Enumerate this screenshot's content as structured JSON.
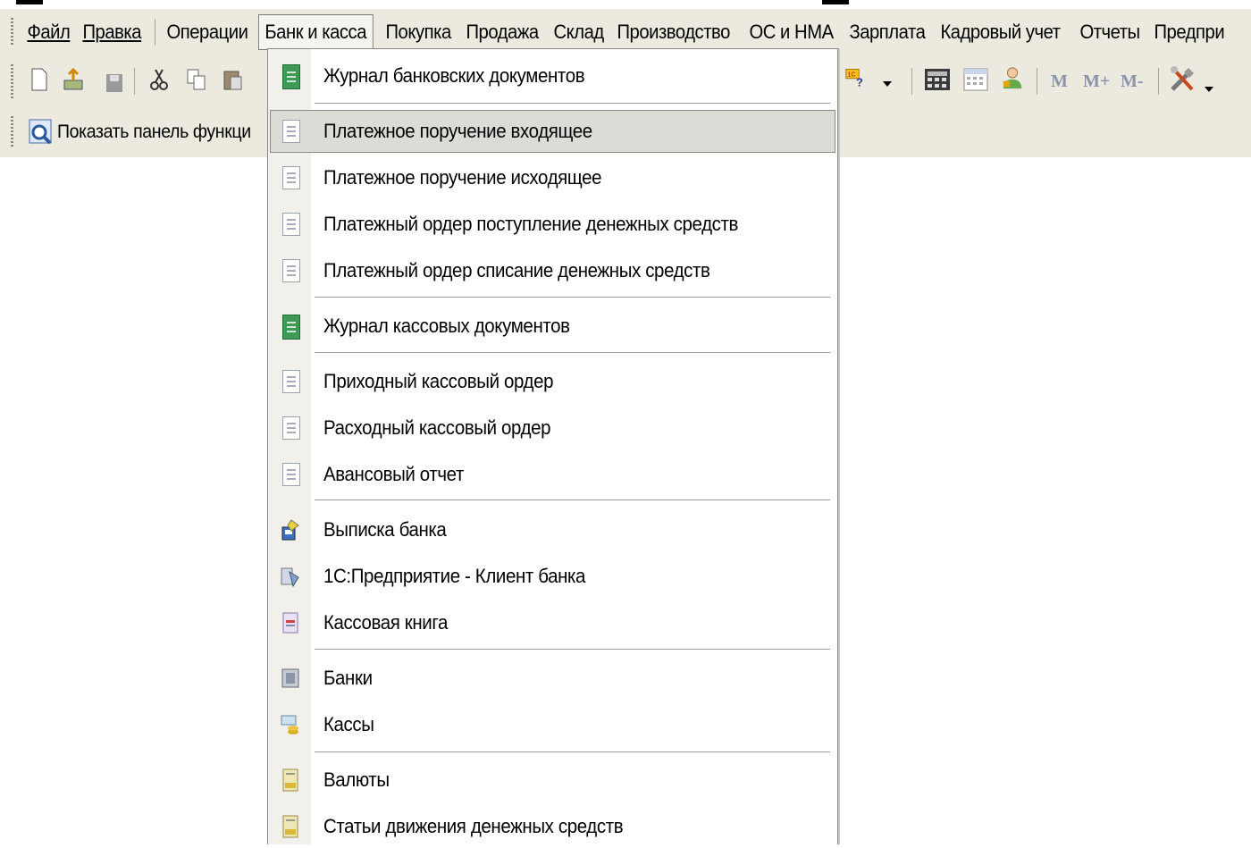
{
  "menubar": {
    "items": [
      {
        "label": "Файл",
        "underline_first": true
      },
      {
        "label": "Правка",
        "underline_first": true
      },
      {
        "label": "Операции"
      },
      {
        "label": "Банк и касса",
        "active": true
      },
      {
        "label": "Покупка"
      },
      {
        "label": "Продажа"
      },
      {
        "label": "Склад"
      },
      {
        "label": "Производство"
      },
      {
        "label": "ОС и НМА"
      },
      {
        "label": "Зарплата"
      },
      {
        "label": "Кадровый учет"
      },
      {
        "label": "Отчеты"
      },
      {
        "label": "Предпри"
      }
    ]
  },
  "toolbar": {
    "memory_buttons": [
      "M",
      "M+",
      "M-"
    ],
    "icons": [
      "new-document-icon",
      "open-icon",
      "save-icon",
      "cut-icon",
      "copy-icon",
      "paste-icon",
      "help-icon",
      "calculator-icon",
      "calendar-icon",
      "user-icon",
      "settings-icon"
    ]
  },
  "toolbar2": {
    "show_panel_label": "Показать панель функци"
  },
  "dropdown": {
    "items": [
      {
        "label": "Журнал банковских документов",
        "icon": "journal-icon"
      },
      {
        "label": "Платежное поручение входящее",
        "icon": "document-icon",
        "highlighted": true
      },
      {
        "label": "Платежное поручение исходящее",
        "icon": "document-icon"
      },
      {
        "label": "Платежный ордер поступление денежных средств",
        "icon": "document-icon"
      },
      {
        "label": "Платежный ордер списание денежных средств",
        "icon": "document-icon"
      },
      {
        "label": "Журнал кассовых документов",
        "icon": "journal-icon"
      },
      {
        "label": "Приходный кассовый ордер",
        "icon": "document-icon"
      },
      {
        "label": "Расходный кассовый ордер",
        "icon": "document-icon"
      },
      {
        "label": "Авансовый отчет",
        "icon": "document-icon"
      },
      {
        "label": "Выписка банка",
        "icon": "bank-statement-icon"
      },
      {
        "label": "1С:Предприятие - Клиент банка",
        "icon": "bank-client-icon"
      },
      {
        "label": "Кассовая книга",
        "icon": "cash-book-icon"
      },
      {
        "label": "Банки",
        "icon": "banks-icon"
      },
      {
        "label": "Кассы",
        "icon": "cash-registers-icon"
      },
      {
        "label": "Валюты",
        "icon": "currency-icon"
      },
      {
        "label": "Статьи движения денежных средств",
        "icon": "cash-flow-items-icon"
      }
    ]
  },
  "colors": {
    "bar_bg": "#eceadf",
    "highlight_bg": "#dcdcd7",
    "journal_green": "#3f9a56"
  }
}
